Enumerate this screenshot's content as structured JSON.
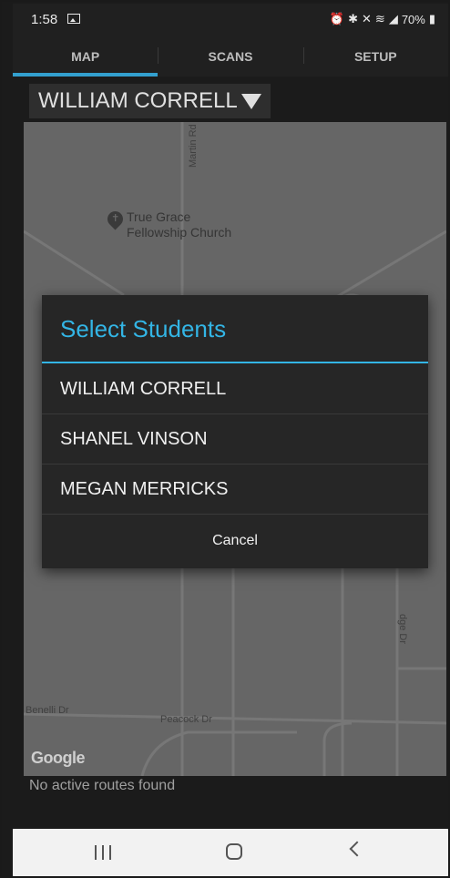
{
  "status": {
    "time": "1:58",
    "battery": "70%",
    "icons": [
      "image-icon",
      "alarm-icon",
      "bluetooth-icon",
      "mute-icon",
      "wifi-icon",
      "signal-icon",
      "battery-icon"
    ]
  },
  "tabs": [
    {
      "label": "MAP",
      "active": true
    },
    {
      "label": "SCANS",
      "active": false
    },
    {
      "label": "SETUP",
      "active": false
    }
  ],
  "selector": {
    "value": "WILLIAM CORRELL"
  },
  "map": {
    "road_labels": {
      "martin": "Martin Rd",
      "benelli": "Benelli Dr",
      "peacock": "Peacock Dr",
      "lodge": "dge Dr"
    },
    "poi": {
      "line1": "True Grace",
      "line2": "Fellowship Church"
    },
    "attribution": "Google"
  },
  "dialog": {
    "title": "Select Students",
    "options": [
      "WILLIAM CORRELL",
      "SHANEL VINSON",
      "MEGAN MERRICKS"
    ],
    "cancel_label": "Cancel"
  },
  "footer": {
    "routes_text": "No active routes found"
  },
  "colors": {
    "accent": "#33b5e5",
    "tab_indicator": "#33a0cf",
    "background": "#1b1b1b"
  }
}
